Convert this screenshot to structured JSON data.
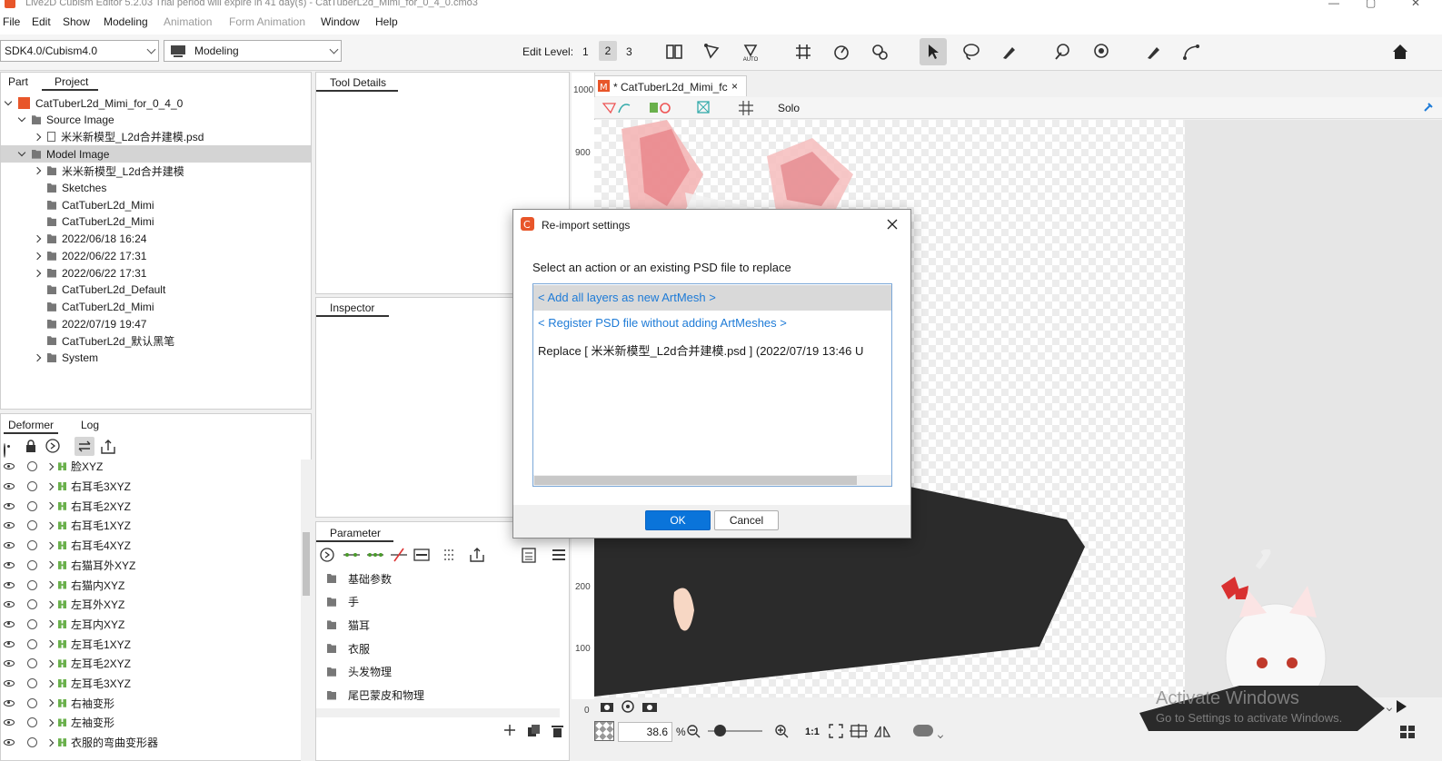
{
  "window": {
    "title": "Live2D Cubism Editor 5.2.03    Trial period will expire in 41 day(s)    - CatTuberL2d_Mimi_for_0_4_0.cmo3"
  },
  "menu": [
    "File",
    "Edit",
    "Show",
    "Modeling",
    "Animation",
    "Form Animation",
    "Window",
    "Help"
  ],
  "toolbar": {
    "sdk_select": "SDK4.0/Cubism4.0",
    "mode_select": "Modeling",
    "edit_level_label": "Edit Level:",
    "edit_levels": [
      "1",
      "2",
      "3"
    ],
    "active_level": "2",
    "auto_label": "AUTO"
  },
  "project_panel": {
    "tabs": [
      "Part",
      "Project"
    ],
    "active_tab": "Project",
    "root": "CatTuberL2d_Mimi_for_0_4_0",
    "items": [
      {
        "label": "Source Image",
        "depth": 1,
        "expander": "open"
      },
      {
        "label": "米米新模型_L2d合并建模.psd",
        "depth": 2,
        "expander": "closed",
        "icon": "file"
      },
      {
        "label": "Model Image",
        "depth": 1,
        "expander": "open",
        "selected": true
      },
      {
        "label": "米米新模型_L2d合并建模",
        "depth": 2,
        "expander": "closed"
      },
      {
        "label": "Sketches",
        "depth": 2,
        "expander": "none"
      },
      {
        "label": "CatTuberL2d_Mimi",
        "depth": 2,
        "expander": "none"
      },
      {
        "label": "CatTuberL2d_Mimi",
        "depth": 2,
        "expander": "none"
      },
      {
        "label": "2022/06/18 16:24",
        "depth": 2,
        "expander": "closed"
      },
      {
        "label": "2022/06/22 17:31",
        "depth": 2,
        "expander": "closed"
      },
      {
        "label": "2022/06/22 17:31",
        "depth": 2,
        "expander": "closed"
      },
      {
        "label": "CatTuberL2d_Default",
        "depth": 2,
        "expander": "none"
      },
      {
        "label": "CatTuberL2d_Mimi",
        "depth": 2,
        "expander": "none"
      },
      {
        "label": "2022/07/19 19:47",
        "depth": 2,
        "expander": "none"
      },
      {
        "label": "CatTuberL2d_默认黑笔",
        "depth": 2,
        "expander": "none"
      },
      {
        "label": "System",
        "depth": 2,
        "expander": "closed"
      }
    ]
  },
  "deformer_panel": {
    "tabs": [
      "Deformer",
      "Log"
    ],
    "rows": [
      "脸XYZ",
      "右耳毛3XYZ",
      "右耳毛2XYZ",
      "右耳毛1XYZ",
      "右耳毛4XYZ",
      "右猫耳外XYZ",
      "右猫内XYZ",
      "左耳外XYZ",
      "左耳内XYZ",
      "左耳毛1XYZ",
      "左耳毛2XYZ",
      "左耳毛3XYZ",
      "右袖变形",
      "左袖变形",
      "衣服的弯曲变形器"
    ]
  },
  "tool_details": {
    "title": "Tool Details"
  },
  "inspector": {
    "title": "Inspector"
  },
  "parameter_panel": {
    "title": "Parameter",
    "groups": [
      "基础参数",
      "手",
      "猫耳",
      "衣服",
      "头发物理",
      "尾巴蒙皮和物理"
    ]
  },
  "canvas": {
    "tab_label": "* CatTuberL2d_Mimi_fc",
    "solo_label": "Solo",
    "ruler_marks": [
      "1000",
      "900",
      "200",
      "100",
      "0"
    ],
    "zoom_value": "38.6",
    "zoom_unit": "%",
    "ratio_label": "1:1"
  },
  "dialog": {
    "title": "Re-import settings",
    "prompt": "Select an action or an existing PSD file to replace",
    "options": [
      {
        "label": "< Add all layers as new ArtMesh >",
        "type": "link",
        "selected": true
      },
      {
        "label": "< Register PSD file without adding ArtMeshes >",
        "type": "link",
        "selected": false
      },
      {
        "label": "Replace [ 米米新模型_L2d合并建模.psd  ]   (2022/07/19 13:46 U",
        "type": "text",
        "selected": false
      }
    ],
    "ok_label": "OK",
    "cancel_label": "Cancel"
  },
  "watermark": {
    "line1": "Activate Windows",
    "line2": "Go to Settings to activate Windows."
  },
  "colors": {
    "accent": "#0a74da",
    "link": "#1e7bd7",
    "selection": "#cfcfcf",
    "logo": "#e8562a"
  }
}
